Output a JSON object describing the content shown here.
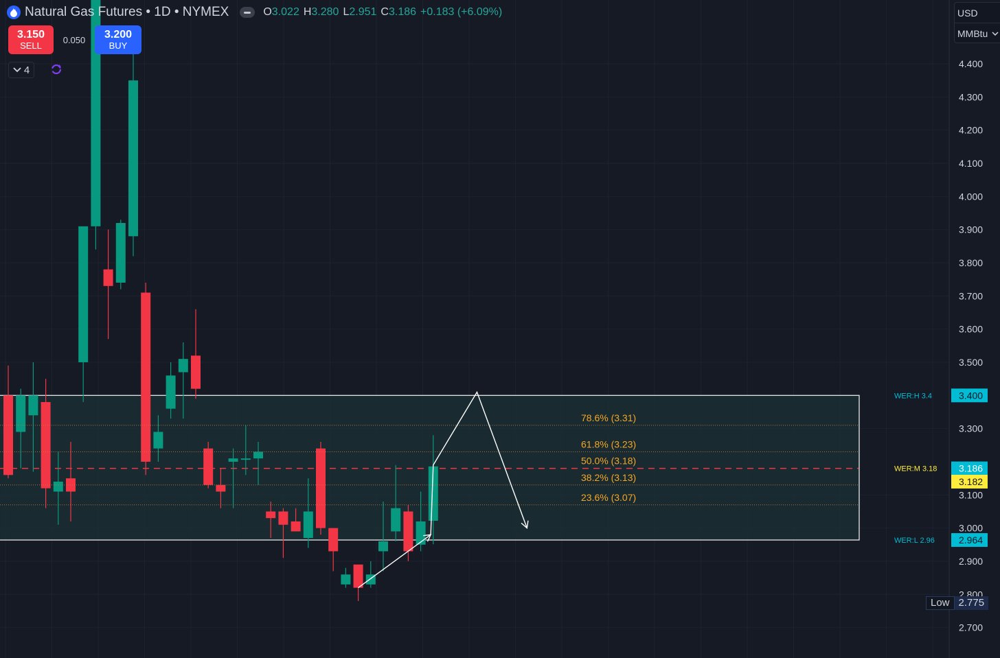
{
  "header": {
    "title": "Natural Gas Futures • 1D • NYMEX",
    "ohlc": [
      {
        "k": "O",
        "v": "3.022"
      },
      {
        "k": "H",
        "v": "3.280"
      },
      {
        "k": "L",
        "v": "2.951"
      },
      {
        "k": "C",
        "v": "3.186"
      },
      {
        "k": "",
        "v": "+0.183 (+6.09%)"
      }
    ]
  },
  "trade": {
    "sell_price": "3.150",
    "sell_label": "SELL",
    "spread": "0.050",
    "buy_price": "3.200",
    "buy_label": "BUY"
  },
  "indicators": {
    "count": "4"
  },
  "units": {
    "currency": "USD",
    "unit": "MMBtu"
  },
  "low_tag": {
    "label": "Low",
    "value": "2.775"
  },
  "colors": {
    "background": "#161a25",
    "up": "#089981",
    "down": "#f23645",
    "fib": "#f5a623",
    "zone": "#1b3236",
    "tag_cyan": "#00bcd4",
    "tag_yellow": "#ffeb3b"
  },
  "chart_data": {
    "type": "candlestick",
    "title": "Natural Gas Futures • 1D • NYMEX",
    "ylim": [
      2.64,
      4.58
    ],
    "y_ticks": [
      "4.400",
      "4.300",
      "4.200",
      "4.100",
      "4.000",
      "3.900",
      "3.800",
      "3.700",
      "3.600",
      "3.500",
      "3.300",
      "3.100",
      "3.000",
      "2.900",
      "2.800",
      "2.700"
    ],
    "candles": [
      {
        "o": 3.4,
        "h": 3.49,
        "l": 3.15,
        "c": 3.16
      },
      {
        "o": 3.29,
        "h": 3.42,
        "l": 3.18,
        "c": 3.4
      },
      {
        "o": 3.34,
        "h": 3.5,
        "l": 3.17,
        "c": 3.4
      },
      {
        "o": 3.38,
        "h": 3.45,
        "l": 3.06,
        "c": 3.12
      },
      {
        "o": 3.11,
        "h": 3.23,
        "l": 3.01,
        "c": 3.14
      },
      {
        "o": 3.15,
        "h": 3.26,
        "l": 3.02,
        "c": 3.11
      },
      {
        "o": 3.5,
        "h": 3.57,
        "l": 3.38,
        "c": 3.91
      },
      {
        "o": 3.91,
        "h": 4.6,
        "l": 3.84,
        "c": 4.6
      },
      {
        "o": 3.78,
        "h": 3.9,
        "l": 3.57,
        "c": 3.73
      },
      {
        "o": 3.74,
        "h": 3.93,
        "l": 3.72,
        "c": 3.92
      },
      {
        "o": 3.88,
        "h": 4.43,
        "l": 3.82,
        "c": 4.35
      },
      {
        "o": 3.71,
        "h": 3.74,
        "l": 3.16,
        "c": 3.2
      },
      {
        "o": 3.24,
        "h": 3.34,
        "l": 3.2,
        "c": 3.29
      },
      {
        "o": 3.36,
        "h": 3.5,
        "l": 3.33,
        "c": 3.46
      },
      {
        "o": 3.47,
        "h": 3.56,
        "l": 3.33,
        "c": 3.51
      },
      {
        "o": 3.52,
        "h": 3.66,
        "l": 3.39,
        "c": 3.42
      },
      {
        "o": 3.24,
        "h": 3.26,
        "l": 3.12,
        "c": 3.13
      },
      {
        "o": 3.13,
        "h": 3.18,
        "l": 3.06,
        "c": 3.11
      },
      {
        "o": 3.2,
        "h": 3.24,
        "l": 3.06,
        "c": 3.21
      },
      {
        "o": 3.21,
        "h": 3.31,
        "l": 3.16,
        "c": 3.21
      },
      {
        "o": 3.21,
        "h": 3.26,
        "l": 3.13,
        "c": 3.23
      },
      {
        "o": 3.05,
        "h": 3.08,
        "l": 2.97,
        "c": 3.03
      },
      {
        "o": 3.05,
        "h": 3.06,
        "l": 2.91,
        "c": 3.01
      },
      {
        "o": 3.02,
        "h": 3.06,
        "l": 2.99,
        "c": 2.99
      },
      {
        "o": 2.97,
        "h": 3.15,
        "l": 2.94,
        "c": 3.05
      },
      {
        "o": 3.24,
        "h": 3.26,
        "l": 2.98,
        "c": 3.0
      },
      {
        "o": 3.0,
        "h": 3.0,
        "l": 2.87,
        "c": 2.93
      },
      {
        "o": 2.83,
        "h": 2.88,
        "l": 2.82,
        "c": 2.86
      },
      {
        "o": 2.89,
        "h": 2.89,
        "l": 2.78,
        "c": 2.82
      },
      {
        "o": 2.83,
        "h": 2.9,
        "l": 2.82,
        "c": 2.86
      },
      {
        "o": 2.93,
        "h": 3.08,
        "l": 2.87,
        "c": 2.96
      },
      {
        "o": 2.99,
        "h": 3.19,
        "l": 2.96,
        "c": 3.06
      },
      {
        "o": 3.05,
        "h": 3.07,
        "l": 2.9,
        "c": 2.93
      },
      {
        "o": 2.95,
        "h": 3.11,
        "l": 2.93,
        "c": 3.02
      },
      {
        "o": 3.022,
        "h": 3.28,
        "l": 2.951,
        "c": 3.186
      }
    ],
    "zone": {
      "top": 3.4,
      "bottom": 2.964
    },
    "fib_levels": [
      {
        "pct": 0.786,
        "value": 3.31,
        "label": "78.6% (3.31)"
      },
      {
        "pct": 0.618,
        "value": 3.23,
        "label": "61.8% (3.23)"
      },
      {
        "pct": 0.5,
        "value": 3.18,
        "label": "50.0% (3.18)"
      },
      {
        "pct": 0.382,
        "value": 3.13,
        "label": "38.2% (3.13)"
      },
      {
        "pct": 0.236,
        "value": 3.07,
        "label": "23.6% (3.07)"
      }
    ],
    "level_labels": [
      {
        "name": "WER:H 3.4",
        "value": 3.4,
        "tag": "3.400",
        "color": "#00bcd4"
      },
      {
        "name": "WER:M 3.18",
        "value": 3.18,
        "tag": "3.186",
        "color": "#00bcd4"
      },
      {
        "name": "WER:L 2.96",
        "value": 2.964,
        "tag": "2.964",
        "color": "#00bcd4"
      }
    ],
    "last_price_tag": "3.182",
    "projection_path": [
      {
        "candle": 28,
        "y": 2.82
      },
      {
        "candle": 33.8,
        "y": 2.98
      },
      {
        "candle": 34,
        "y": 3.19
      },
      {
        "candle": 37.5,
        "y": 3.41
      },
      {
        "candle": 41.5,
        "y": 3.0
      }
    ]
  }
}
